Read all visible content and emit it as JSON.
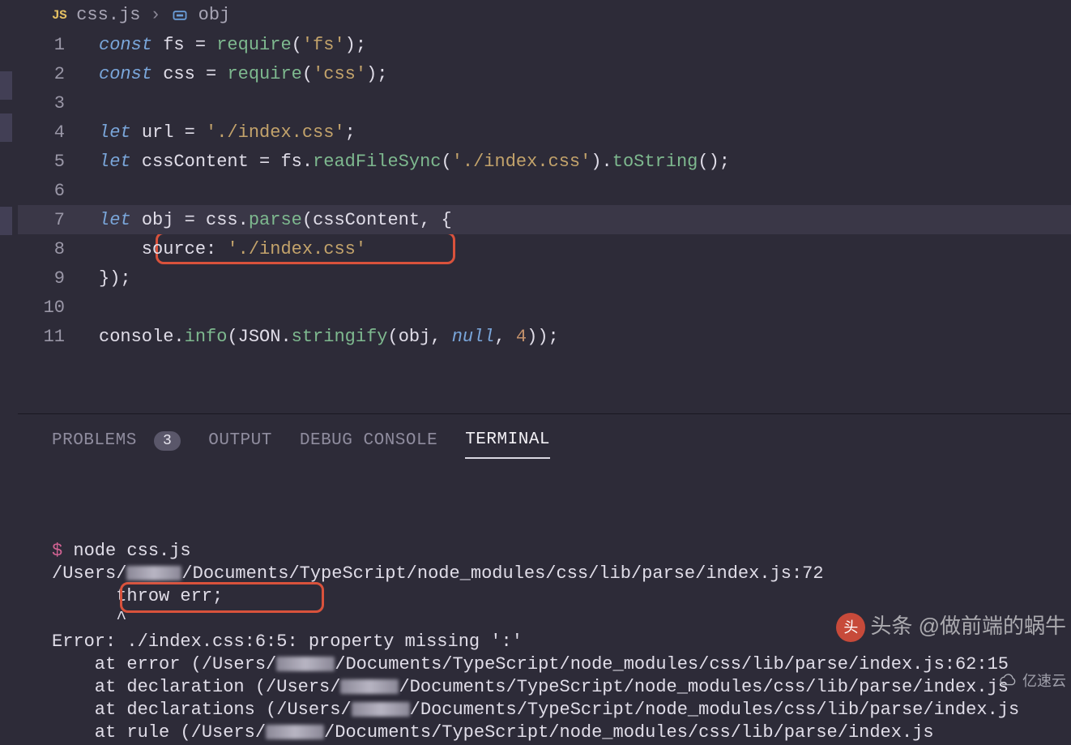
{
  "breadcrumb": {
    "badge": "JS",
    "file": "css.js",
    "symbol": "obj"
  },
  "code": {
    "lines": [
      [
        {
          "t": "const ",
          "c": "kw-decl"
        },
        {
          "t": "fs ",
          "c": "ident"
        },
        {
          "t": "= ",
          "c": "op"
        },
        {
          "t": "require",
          "c": "fn-call"
        },
        {
          "t": "(",
          "c": "punct"
        },
        {
          "t": "'fs'",
          "c": "str"
        },
        {
          "t": ");",
          "c": "punct"
        }
      ],
      [
        {
          "t": "const ",
          "c": "kw-decl"
        },
        {
          "t": "css ",
          "c": "ident"
        },
        {
          "t": "= ",
          "c": "op"
        },
        {
          "t": "require",
          "c": "fn-call"
        },
        {
          "t": "(",
          "c": "punct"
        },
        {
          "t": "'css'",
          "c": "str"
        },
        {
          "t": ");",
          "c": "punct"
        }
      ],
      [],
      [
        {
          "t": "let ",
          "c": "kw-decl"
        },
        {
          "t": "url ",
          "c": "ident"
        },
        {
          "t": "= ",
          "c": "op"
        },
        {
          "t": "'./index.css'",
          "c": "str"
        },
        {
          "t": ";",
          "c": "punct"
        }
      ],
      [
        {
          "t": "let ",
          "c": "kw-decl"
        },
        {
          "t": "cssContent ",
          "c": "ident"
        },
        {
          "t": "= ",
          "c": "op"
        },
        {
          "t": "fs",
          "c": "const-obj"
        },
        {
          "t": ".",
          "c": "punct"
        },
        {
          "t": "readFileSync",
          "c": "fn-call"
        },
        {
          "t": "(",
          "c": "punct"
        },
        {
          "t": "'./index.css'",
          "c": "str"
        },
        {
          "t": ").",
          "c": "punct"
        },
        {
          "t": "toString",
          "c": "fn-call"
        },
        {
          "t": "();",
          "c": "punct"
        }
      ],
      [],
      [
        {
          "t": "let ",
          "c": "kw-decl"
        },
        {
          "t": "obj ",
          "c": "ident"
        },
        {
          "t": "= ",
          "c": "op"
        },
        {
          "t": "css",
          "c": "const-obj"
        },
        {
          "t": ".",
          "c": "punct"
        },
        {
          "t": "parse",
          "c": "fn-call"
        },
        {
          "t": "(",
          "c": "punct"
        },
        {
          "t": "cssContent",
          "c": "ident"
        },
        {
          "t": ", {",
          "c": "punct"
        }
      ],
      [
        {
          "t": "    source",
          "c": "prop"
        },
        {
          "t": ": ",
          "c": "punct"
        },
        {
          "t": "'./index.css'",
          "c": "str"
        }
      ],
      [
        {
          "t": "});",
          "c": "punct"
        }
      ],
      [],
      [
        {
          "t": "console",
          "c": "const-obj"
        },
        {
          "t": ".",
          "c": "punct"
        },
        {
          "t": "info",
          "c": "fn-call"
        },
        {
          "t": "(",
          "c": "punct"
        },
        {
          "t": "JSON",
          "c": "const-obj"
        },
        {
          "t": ".",
          "c": "punct"
        },
        {
          "t": "stringify",
          "c": "fn-call"
        },
        {
          "t": "(",
          "c": "punct"
        },
        {
          "t": "obj",
          "c": "ident"
        },
        {
          "t": ", ",
          "c": "punct"
        },
        {
          "t": "null",
          "c": "null-kw"
        },
        {
          "t": ", ",
          "c": "punct"
        },
        {
          "t": "4",
          "c": "num"
        },
        {
          "t": "));",
          "c": "punct"
        }
      ]
    ],
    "highlighted_line_index": 6
  },
  "panel": {
    "tabs": {
      "problems": "PROBLEMS",
      "problems_badge": "3",
      "output": "OUTPUT",
      "debug": "DEBUG CONSOLE",
      "terminal": "TERMINAL"
    }
  },
  "terminal": {
    "prompt": "$",
    "cmd": "node css.js",
    "path_line_a": "/Users/",
    "path_line_b": "/Documents/TypeScript/node_modules/css/lib/parse/index.js:72",
    "throw_line": "      throw err;",
    "caret_line": "      ^",
    "blank": "",
    "err_prefix": "Error: ",
    "err_highlight": "./index.css:6:5: ",
    "err_suffix": "property missing ':'",
    "stack": [
      {
        "a": "    at error (/Users/",
        "b": "/Documents/TypeScript/node_modules/css/lib/parse/index.js:62:15"
      },
      {
        "a": "    at declaration (/Users/",
        "b": "/Documents/TypeScript/node_modules/css/lib/parse/index.js"
      },
      {
        "a": "    at declarations (/Users/",
        "b": "/Documents/TypeScript/node_modules/css/lib/parse/index.js"
      },
      {
        "a": "    at rule (/Users/",
        "b": "/Documents/TypeScript/node_modules/css/lib/parse/index.js"
      }
    ]
  },
  "watermark": {
    "text": "头条 @做前端的蜗牛",
    "site": "亿速云"
  }
}
